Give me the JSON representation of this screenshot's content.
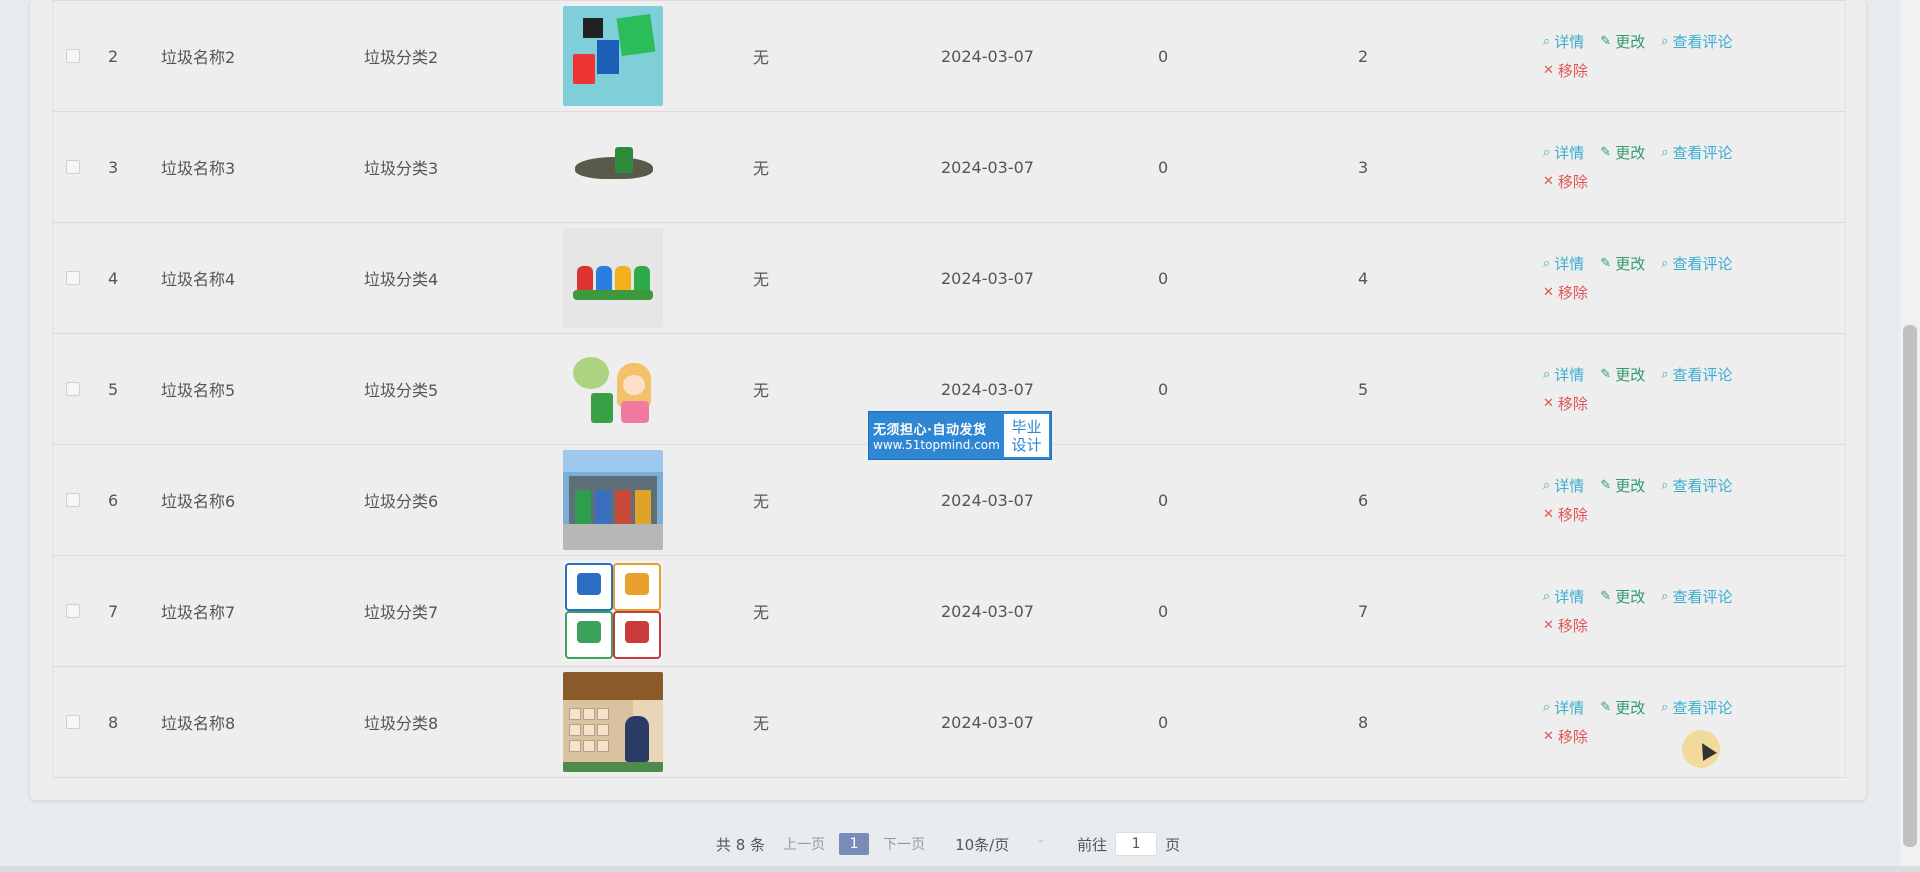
{
  "rows": [
    {
      "index": "2",
      "name": "垃圾名称2",
      "category": "垃圾分类2",
      "thumb": "bins-box-image",
      "col_wu": "无",
      "date": "2024-03-07",
      "zero": "0",
      "num": "2"
    },
    {
      "index": "3",
      "name": "垃圾名称3",
      "category": "垃圾分类3",
      "thumb": "trash-pile-image",
      "col_wu": "无",
      "date": "2024-03-07",
      "zero": "0",
      "num": "3"
    },
    {
      "index": "4",
      "name": "垃圾名称4",
      "category": "垃圾分类4",
      "thumb": "four-bins-image",
      "col_wu": "无",
      "date": "2024-03-07",
      "zero": "0",
      "num": "4"
    },
    {
      "index": "5",
      "name": "垃圾名称5",
      "category": "垃圾分类5",
      "thumb": "girl-recycling-image",
      "col_wu": "无",
      "date": "2024-03-07",
      "zero": "0",
      "num": "5"
    },
    {
      "index": "6",
      "name": "垃圾名称6",
      "category": "垃圾分类6",
      "thumb": "collection-station-image",
      "col_wu": "无",
      "date": "2024-03-07",
      "zero": "0",
      "num": "6"
    },
    {
      "index": "7",
      "name": "垃圾名称7",
      "category": "垃圾分类7",
      "thumb": "category-signs-image",
      "col_wu": "无",
      "date": "2024-03-07",
      "zero": "0",
      "num": "7"
    },
    {
      "index": "8",
      "name": "垃圾名称8",
      "category": "垃圾分类8",
      "thumb": "classroom-board-image",
      "col_wu": "无",
      "date": "2024-03-07",
      "zero": "0",
      "num": "8"
    }
  ],
  "actions": {
    "detail": "详情",
    "edit": "更改",
    "review": "查看评论",
    "remove": "移除"
  },
  "watermark": {
    "line1": "无须担心·自动发货",
    "line2": "www.51topmind.com",
    "right1": "毕业",
    "right2": "设计"
  },
  "pagination": {
    "total": "共 8 条",
    "prev": "上一页",
    "current": "1",
    "next": "下一页",
    "page_size": "10条/页",
    "goto_prefix": "前往",
    "goto_value": "1",
    "goto_suffix": "页"
  },
  "colors": {
    "detail": "#3aaecf",
    "edit": "#2f9c6e",
    "remove": "#e05656",
    "current_page": "#7a8bb8"
  }
}
